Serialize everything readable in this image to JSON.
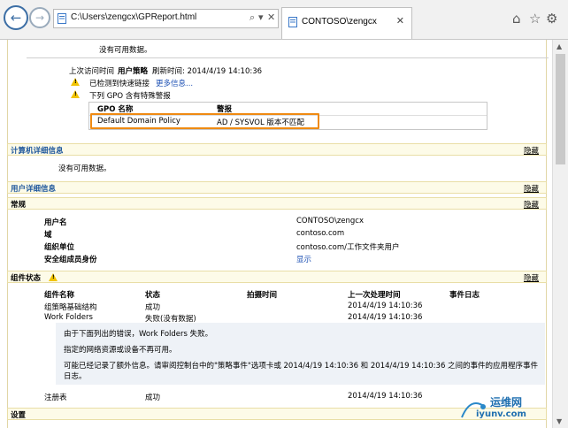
{
  "browser": {
    "address_url": "C:\\Users\\zengcx\\GPReport.html",
    "tab_title": "CONTOSO\\zengcx"
  },
  "top": {
    "no_data": "没有可用数据。",
    "last_visit_label": "上次访问时间",
    "last_visit_policy": "用户策略",
    "refresh_time": "刷新时间: 2014/4/19 14:10:36",
    "fast_link_text": "已检测到快速链接",
    "more_info_link": "更多信息...",
    "gpo_warning_text": "下列 GPO 含有特殊警报",
    "gpo_table": {
      "headers": [
        "GPO 名称",
        "警报"
      ],
      "rows": [
        [
          "Default Domain Policy",
          "AD / SYSVOL 版本不匹配"
        ]
      ]
    }
  },
  "computer_details": {
    "title": "计算机详细信息",
    "hide_label": "隐藏",
    "no_data": "没有可用数据。"
  },
  "user_details": {
    "title": "用户详细信息",
    "hide_label": "隐藏",
    "general": {
      "title": "常规",
      "hide_label": "隐藏",
      "rows": [
        {
          "label": "用户名",
          "value": "CONTOSO\\zengcx"
        },
        {
          "label": "域",
          "value": "contoso.com"
        },
        {
          "label": "组织单位",
          "value": "contoso.com/工作文件夹用户"
        },
        {
          "label": "安全组成员身份",
          "value": "显示"
        }
      ]
    },
    "component_status": {
      "title": "组件状态",
      "hide_label": "隐藏",
      "headers": [
        "组件名称",
        "状态",
        "拍摄时间",
        "上一次处理时间",
        "事件日志"
      ],
      "rows": [
        {
          "name": "组策略基础结构",
          "status": "成功",
          "time": "2014/4/19 14:10:36"
        },
        {
          "name": "Work Folders",
          "status": "失败(没有数据)",
          "time": "2014/4/19 14:10:36"
        }
      ],
      "messages": [
        "由于下面列出的错误，Work Folders 失败。",
        "指定的网络资源或设备不再可用。",
        "可能已经记录了额外信息。请审阅控制台中的\"策略事件\"选项卡或 2014/4/19 14:10:36 和 2014/4/19 14:10:36 之间的事件的应用程序事件",
        "日志。"
      ],
      "registry_row": {
        "name": "注册表",
        "status": "成功",
        "time": "2014/4/19 14:10:36"
      }
    },
    "settings": {
      "title": "设置"
    }
  },
  "watermark": {
    "line1": "运维网",
    "line2": "iyunv.com"
  }
}
